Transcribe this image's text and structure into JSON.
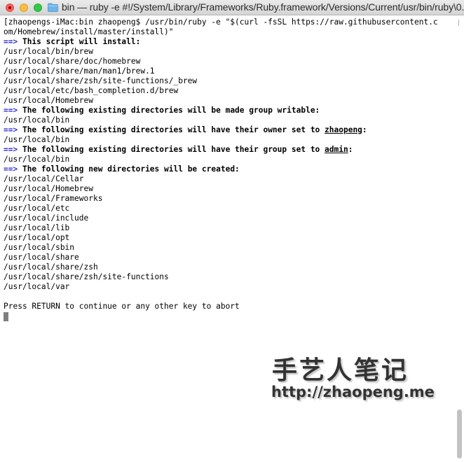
{
  "window": {
    "title": "bin — ruby -e #!/System/Library/Frameworks/Ruby.framework/Versions/Current/usr/bin/ruby\\0..."
  },
  "terminal": {
    "lines": [
      {
        "text": "[zhaopengs-iMac:bin zhaopeng$ /usr/bin/ruby -e \"$(curl -fsSL https://raw.githubusercontent.c"
      },
      {
        "text": "om/Homebrew/install/master/install)\""
      },
      {
        "arrow": "==>",
        "text": " This script will install:",
        "bold": true
      },
      {
        "text": "/usr/local/bin/brew"
      },
      {
        "text": "/usr/local/share/doc/homebrew"
      },
      {
        "text": "/usr/local/share/man/man1/brew.1"
      },
      {
        "text": "/usr/local/share/zsh/site-functions/_brew"
      },
      {
        "text": "/usr/local/etc/bash_completion.d/brew"
      },
      {
        "text": "/usr/local/Homebrew"
      },
      {
        "arrow": "==>",
        "text": " The following existing directories will be made group writable:",
        "bold": true
      },
      {
        "text": "/usr/local/bin"
      },
      {
        "arrow": "==>",
        "text": " The following existing directories will have their owner set to ",
        "u": "zhaopeng",
        "tail": ":",
        "bold": true
      },
      {
        "text": "/usr/local/bin"
      },
      {
        "arrow": "==>",
        "text": " The following existing directories will have their group set to ",
        "u": "admin",
        "tail": ":",
        "bold": true
      },
      {
        "text": "/usr/local/bin"
      },
      {
        "arrow": "==>",
        "text": " The following new directories will be created:",
        "bold": true
      },
      {
        "text": "/usr/local/Cellar"
      },
      {
        "text": "/usr/local/Homebrew"
      },
      {
        "text": "/usr/local/Frameworks"
      },
      {
        "text": "/usr/local/etc"
      },
      {
        "text": "/usr/local/include"
      },
      {
        "text": "/usr/local/lib"
      },
      {
        "text": "/usr/local/opt"
      },
      {
        "text": "/usr/local/sbin"
      },
      {
        "text": "/usr/local/share"
      },
      {
        "text": "/usr/local/share/zsh"
      },
      {
        "text": "/usr/local/share/zsh/site-functions"
      },
      {
        "text": "/usr/local/var"
      },
      {
        "text": ""
      },
      {
        "text": "Press RETURN to continue or any other key to abort"
      }
    ]
  },
  "watermark": {
    "line1": "手艺人笔记",
    "line2": "http://zhaopeng.me"
  },
  "colors": {
    "arrow": "#2f2fd0",
    "close": "#fc605c",
    "minimize": "#fdbc40",
    "maximize": "#34c84a",
    "folder": "#6fb5e8"
  },
  "icons": {
    "folder": "folder-icon"
  }
}
